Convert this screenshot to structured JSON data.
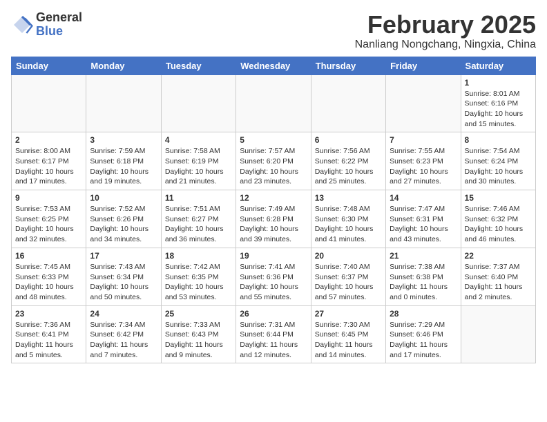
{
  "logo": {
    "general": "General",
    "blue": "Blue"
  },
  "header": {
    "title": "February 2025",
    "subtitle": "Nanliang Nongchang, Ningxia, China"
  },
  "weekdays": [
    "Sunday",
    "Monday",
    "Tuesday",
    "Wednesday",
    "Thursday",
    "Friday",
    "Saturday"
  ],
  "weeks": [
    [
      {
        "day": "",
        "info": ""
      },
      {
        "day": "",
        "info": ""
      },
      {
        "day": "",
        "info": ""
      },
      {
        "day": "",
        "info": ""
      },
      {
        "day": "",
        "info": ""
      },
      {
        "day": "",
        "info": ""
      },
      {
        "day": "1",
        "info": "Sunrise: 8:01 AM\nSunset: 6:16 PM\nDaylight: 10 hours and 15 minutes."
      }
    ],
    [
      {
        "day": "2",
        "info": "Sunrise: 8:00 AM\nSunset: 6:17 PM\nDaylight: 10 hours and 17 minutes."
      },
      {
        "day": "3",
        "info": "Sunrise: 7:59 AM\nSunset: 6:18 PM\nDaylight: 10 hours and 19 minutes."
      },
      {
        "day": "4",
        "info": "Sunrise: 7:58 AM\nSunset: 6:19 PM\nDaylight: 10 hours and 21 minutes."
      },
      {
        "day": "5",
        "info": "Sunrise: 7:57 AM\nSunset: 6:20 PM\nDaylight: 10 hours and 23 minutes."
      },
      {
        "day": "6",
        "info": "Sunrise: 7:56 AM\nSunset: 6:22 PM\nDaylight: 10 hours and 25 minutes."
      },
      {
        "day": "7",
        "info": "Sunrise: 7:55 AM\nSunset: 6:23 PM\nDaylight: 10 hours and 27 minutes."
      },
      {
        "day": "8",
        "info": "Sunrise: 7:54 AM\nSunset: 6:24 PM\nDaylight: 10 hours and 30 minutes."
      }
    ],
    [
      {
        "day": "9",
        "info": "Sunrise: 7:53 AM\nSunset: 6:25 PM\nDaylight: 10 hours and 32 minutes."
      },
      {
        "day": "10",
        "info": "Sunrise: 7:52 AM\nSunset: 6:26 PM\nDaylight: 10 hours and 34 minutes."
      },
      {
        "day": "11",
        "info": "Sunrise: 7:51 AM\nSunset: 6:27 PM\nDaylight: 10 hours and 36 minutes."
      },
      {
        "day": "12",
        "info": "Sunrise: 7:49 AM\nSunset: 6:28 PM\nDaylight: 10 hours and 39 minutes."
      },
      {
        "day": "13",
        "info": "Sunrise: 7:48 AM\nSunset: 6:30 PM\nDaylight: 10 hours and 41 minutes."
      },
      {
        "day": "14",
        "info": "Sunrise: 7:47 AM\nSunset: 6:31 PM\nDaylight: 10 hours and 43 minutes."
      },
      {
        "day": "15",
        "info": "Sunrise: 7:46 AM\nSunset: 6:32 PM\nDaylight: 10 hours and 46 minutes."
      }
    ],
    [
      {
        "day": "16",
        "info": "Sunrise: 7:45 AM\nSunset: 6:33 PM\nDaylight: 10 hours and 48 minutes."
      },
      {
        "day": "17",
        "info": "Sunrise: 7:43 AM\nSunset: 6:34 PM\nDaylight: 10 hours and 50 minutes."
      },
      {
        "day": "18",
        "info": "Sunrise: 7:42 AM\nSunset: 6:35 PM\nDaylight: 10 hours and 53 minutes."
      },
      {
        "day": "19",
        "info": "Sunrise: 7:41 AM\nSunset: 6:36 PM\nDaylight: 10 hours and 55 minutes."
      },
      {
        "day": "20",
        "info": "Sunrise: 7:40 AM\nSunset: 6:37 PM\nDaylight: 10 hours and 57 minutes."
      },
      {
        "day": "21",
        "info": "Sunrise: 7:38 AM\nSunset: 6:38 PM\nDaylight: 11 hours and 0 minutes."
      },
      {
        "day": "22",
        "info": "Sunrise: 7:37 AM\nSunset: 6:40 PM\nDaylight: 11 hours and 2 minutes."
      }
    ],
    [
      {
        "day": "23",
        "info": "Sunrise: 7:36 AM\nSunset: 6:41 PM\nDaylight: 11 hours and 5 minutes."
      },
      {
        "day": "24",
        "info": "Sunrise: 7:34 AM\nSunset: 6:42 PM\nDaylight: 11 hours and 7 minutes."
      },
      {
        "day": "25",
        "info": "Sunrise: 7:33 AM\nSunset: 6:43 PM\nDaylight: 11 hours and 9 minutes."
      },
      {
        "day": "26",
        "info": "Sunrise: 7:31 AM\nSunset: 6:44 PM\nDaylight: 11 hours and 12 minutes."
      },
      {
        "day": "27",
        "info": "Sunrise: 7:30 AM\nSunset: 6:45 PM\nDaylight: 11 hours and 14 minutes."
      },
      {
        "day": "28",
        "info": "Sunrise: 7:29 AM\nSunset: 6:46 PM\nDaylight: 11 hours and 17 minutes."
      },
      {
        "day": "",
        "info": ""
      }
    ]
  ]
}
